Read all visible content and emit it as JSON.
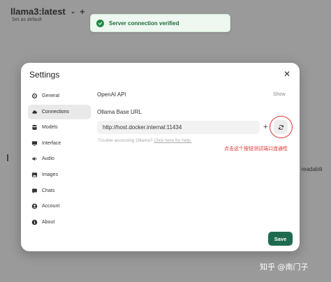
{
  "background": {
    "model_title": "llama3:latest",
    "set_default": "Set as default",
    "partial_text_1": "k",
    "partial_text_2": "er readabili"
  },
  "toast": {
    "message": "Server connection verified",
    "status_color": "#1f8a46"
  },
  "modal": {
    "title": "Settings",
    "sidebar": {
      "items": [
        {
          "label": "General",
          "icon": "gear-icon"
        },
        {
          "label": "Connections",
          "icon": "cloud-icon",
          "active": true
        },
        {
          "label": "Models",
          "icon": "database-icon"
        },
        {
          "label": "Interface",
          "icon": "monitor-icon"
        },
        {
          "label": "Audio",
          "icon": "speaker-icon"
        },
        {
          "label": "Images",
          "icon": "image-icon"
        },
        {
          "label": "Chats",
          "icon": "chat-icon"
        },
        {
          "label": "Account",
          "icon": "user-icon"
        },
        {
          "label": "About",
          "icon": "info-icon"
        }
      ]
    },
    "openai_api": {
      "label": "OpenAI API",
      "show_label": "Show"
    },
    "ollama": {
      "label": "Ollama Base URL",
      "url_value": "http://host.docker.internal:11434",
      "add_label": "+",
      "help_prefix": "Trouble accessing Ollama? ",
      "help_link": "Click here for help."
    },
    "annotation": "点击这个按钮测试端口连通性",
    "save_label": "Save",
    "accent_color": "#1e6b50",
    "annotation_color": "#dd3333"
  },
  "watermark": "知乎 @南门子"
}
